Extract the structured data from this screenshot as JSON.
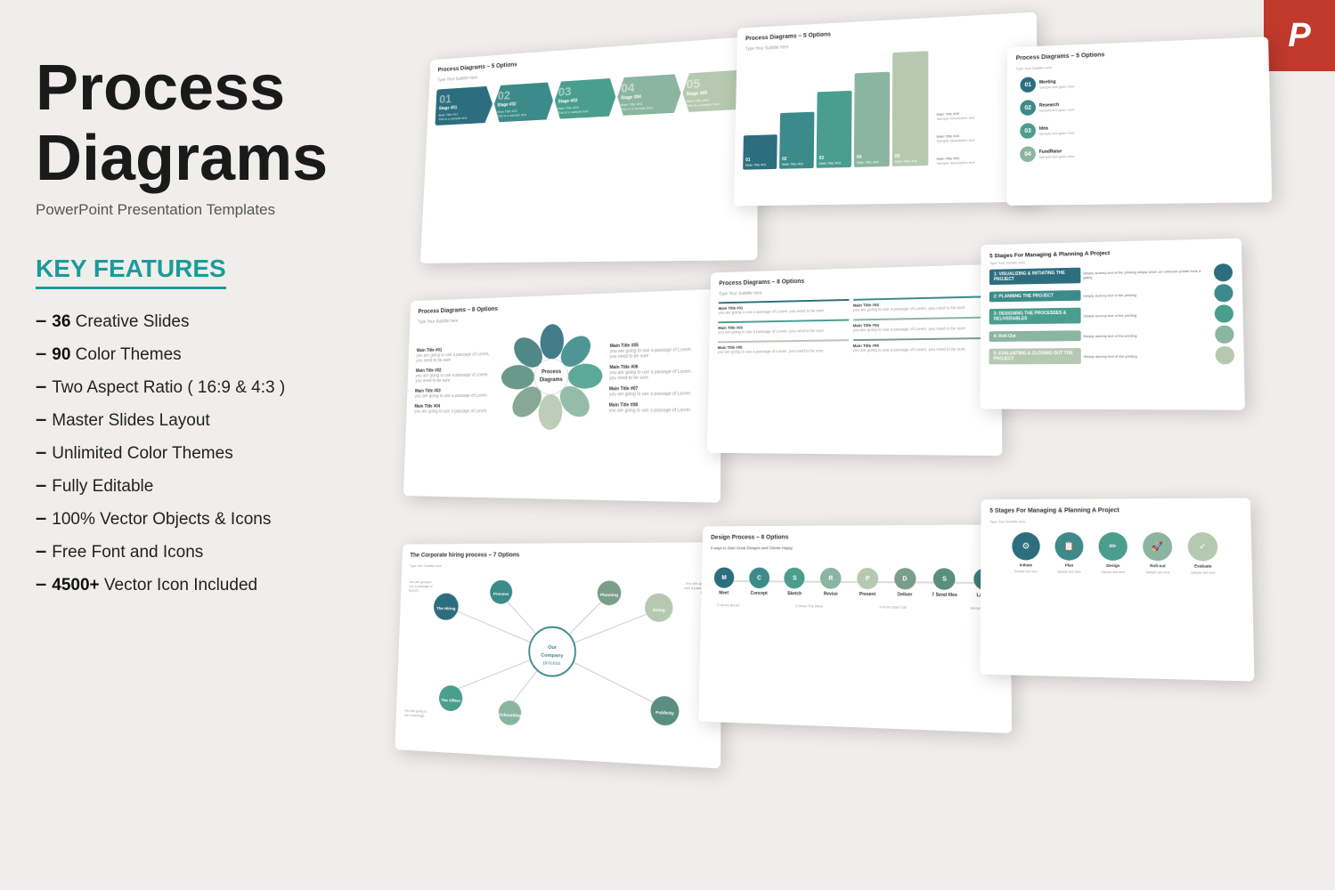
{
  "page": {
    "background": "#eeece8"
  },
  "header": {
    "title": "Process Diagrams",
    "subtitle": "PowerPoint Presentation Templates"
  },
  "features_section": {
    "label": "KEY FEATURES",
    "items": [
      {
        "dash": "–",
        "bold": "36",
        "text": " Creative Slides"
      },
      {
        "dash": "–",
        "bold": "90",
        "text": " Color Themes"
      },
      {
        "dash": "–",
        "text": "Two Aspect Ratio ( 16:9 & 4:3 )"
      },
      {
        "dash": "–",
        "text": "Master Slides Layout"
      },
      {
        "dash": "–",
        "text": "Unlimited Color Themes"
      },
      {
        "dash": "–",
        "text": "Fully Editable"
      },
      {
        "dash": "–",
        "text": "100% Vector Objects & Icons"
      },
      {
        "dash": "–",
        "text": "Free Font and Icons"
      },
      {
        "dash": "–",
        "bold": "4500+",
        "text": " Vector Icon Included"
      }
    ]
  },
  "ppt_badge": {
    "icon": "P"
  },
  "slides": [
    {
      "title": "Process Diagrams – 5 Options",
      "type": "arrow-steps"
    },
    {
      "title": "Process Diagrams – 5 Options",
      "type": "vertical-numbered"
    },
    {
      "title": "Process Diagrams – 5 Options",
      "type": "numbered-list"
    },
    {
      "title": "Process Diagrams – 8 Options",
      "type": "circular"
    },
    {
      "title": "Process Diagrams – 8 Options",
      "type": "text-with-icons"
    },
    {
      "title": "5 Stages For Managing & Planning A Project",
      "type": "stages"
    },
    {
      "title": "The Corporate hiring process – 7 Options",
      "type": "network"
    },
    {
      "title": "Design Process – 8 Options",
      "type": "timeline"
    },
    {
      "title": "",
      "type": "planning"
    }
  ],
  "colors": {
    "teal_dark": "#2d6e7e",
    "teal_mid": "#3d8a8a",
    "teal_light": "#4a9e8e",
    "sage": "#8ab5a0",
    "sage_light": "#b5c9b0",
    "olive": "#7a9e8a",
    "accent_teal": "#1a9b9b",
    "ppt_red": "#c0392b"
  }
}
